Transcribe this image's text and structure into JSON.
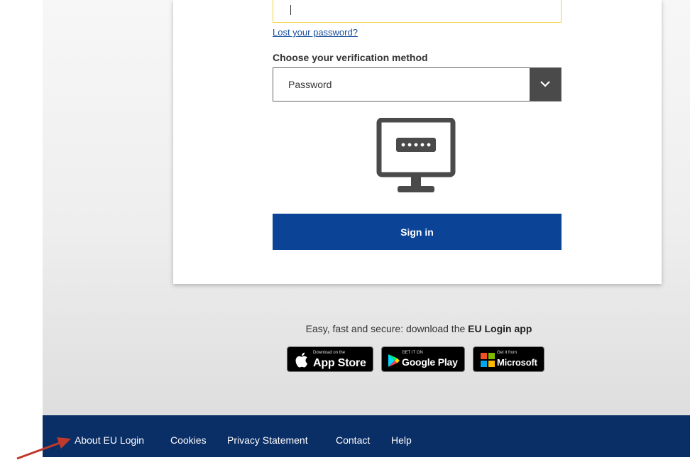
{
  "login_form": {
    "username_value": "",
    "lost_password_link": "Lost your password?",
    "verification_label": "Choose your verification method",
    "verification_method": "Password",
    "signin_label": "Sign in",
    "monitor_icon": "monitor-password-icon"
  },
  "app_promo": {
    "text_prefix": "Easy, fast and secure: download the ",
    "text_bold": "EU Login app",
    "badges": [
      {
        "small": "Download on the",
        "big": "App Store",
        "icon": "apple-icon"
      },
      {
        "small": "GET IT ON",
        "big": "Google Play",
        "icon": "google-play-icon"
      },
      {
        "small": "Get it from",
        "big": "Microsoft",
        "icon": "microsoft-icon"
      }
    ]
  },
  "footer": {
    "links": [
      "About EU Login",
      "Cookies",
      "Privacy Statement",
      "Contact",
      "Help"
    ]
  },
  "annotation": {
    "arrow_icon": "red-arrow-icon",
    "arrow_color": "#c0392b"
  },
  "colors": {
    "primary_blue": "#0b4396",
    "footer_navy": "#0a2e66",
    "input_focus": "#f0d23a",
    "select_chevron_bg": "#4a4a4a"
  }
}
